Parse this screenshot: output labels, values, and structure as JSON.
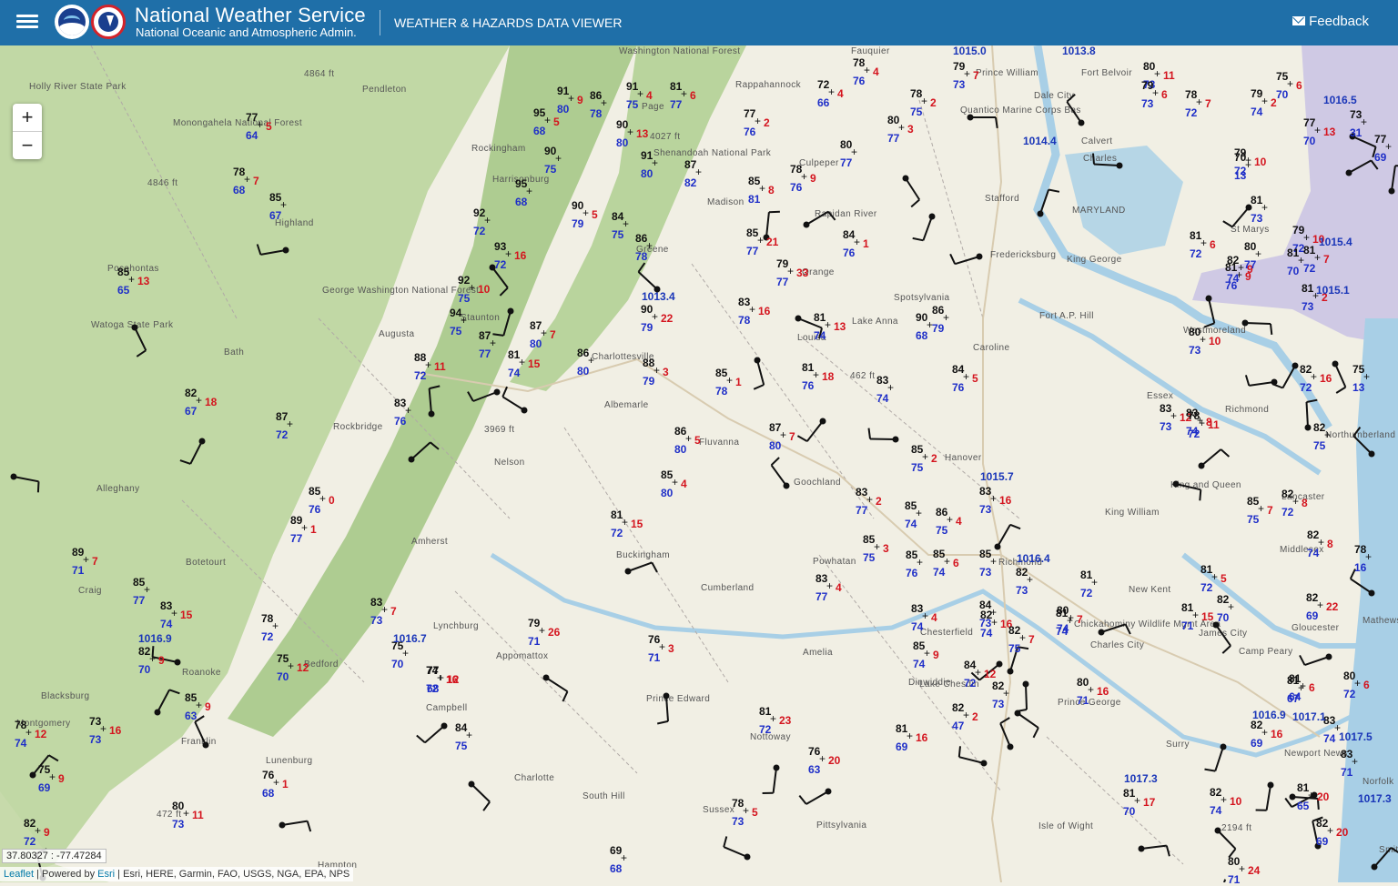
{
  "header": {
    "menu_icon": "hamburger-menu-icon",
    "title": "National Weather Service",
    "subtitle": "National Oceanic and Atmospheric Admin.",
    "app_title": "WEATHER & HAZARDS DATA VIEWER",
    "feedback_label": "Feedback",
    "feedback_icon": "envelope-icon",
    "color": "#1f6fa8"
  },
  "map": {
    "zoom_in": "+",
    "zoom_out": "−",
    "coordinates": "37.80327 : -77.47284",
    "attribution": {
      "leaflet": "Leaflet",
      "powered": " | Powered by ",
      "esri": "Esri",
      "rest": " | Esri, HERE, Garmin, FAO, USGS, NGA, EPA, NPS"
    },
    "colors": {
      "temperature": "#111111",
      "dewpoint": "#1f2fc8",
      "gust": "#d4141e",
      "pressure": "#1a36b8",
      "terrain": "#a9c98a",
      "water": "#a8cfe6",
      "marine_zone": "#c9c2e4"
    },
    "place_labels": [
      "Holly River State Park",
      "Monongahela National Forest",
      "4864 ft",
      "Pendleton",
      "Washington National Forest",
      "Fauquier",
      "Prince William",
      "Dale City",
      "Fort Belvoir",
      "Rappahannock",
      "Page",
      "4027 ft",
      "Shenandoah National Park",
      "Rockingham",
      "Harrisonburg",
      "4846 ft",
      "Highland",
      "Culpeper",
      "Quantico Marine Corps Bas",
      "Charles",
      "Calvert",
      "Madison",
      "Stafford",
      "Greene",
      "Pocahontas",
      "Rapidan River",
      "Fredericksburg",
      "King George",
      "MARYLAND",
      "St Marys",
      "George Washington National Forest",
      "Watoga State Park",
      "Staunton",
      "Augusta",
      "Orange",
      "Spotsylvania",
      "Fort A.P. Hill",
      "Caroline",
      "Westmoreland",
      "Charlottesville",
      "Albemarle",
      "Louisa",
      "Lake Anna",
      "462 ft",
      "Bath",
      "Rockbridge",
      "3969 ft",
      "Fluvanna",
      "Essex",
      "Richmond",
      "Northumberland",
      "Alleghany",
      "Nelson",
      "Goochland",
      "Hanover",
      "King and Queen",
      "King William",
      "Lancaster",
      "Amherst",
      "Buckingham",
      "Botetourt",
      "Richmond",
      "Middlesex",
      "New Kent",
      "Craig",
      "Cumberland",
      "Powhatan",
      "Gloucester",
      "Mathews",
      "Lynchburg",
      "Appomattox",
      "Amelia",
      "Chesterfield",
      "Chickahominy Wildlife Mgmt Area",
      "Charles City",
      "James City",
      "Camp Peary",
      "Roanoke",
      "Bedford",
      "Blacksburg",
      "Montgomery",
      "Franklin",
      "Campbell",
      "Prince Edward",
      "Nottoway",
      "Dinwiddie",
      "Lake Chesdin",
      "Prince George",
      "Surry",
      "Newport News",
      "Charlotte",
      "South Hill",
      "Lunenburg",
      "Sussex",
      "Isle of Wight",
      "2194 ft",
      "472 ft",
      "Pittsylvania",
      "Hampton",
      "Norfolk",
      "Smith Mtn Lake"
    ],
    "stations": [
      {
        "t": "79",
        "d": "73",
        "g": "7"
      },
      {
        "t": "78",
        "d": "76",
        "g": "4"
      },
      {
        "t": "77",
        "d": "64",
        "g": "5"
      },
      {
        "t": "91",
        "d": "80",
        "g": "9"
      },
      {
        "t": "86",
        "d": "78"
      },
      {
        "t": "91",
        "d": "75",
        "g": "4"
      },
      {
        "t": "81",
        "d": "77",
        "g": "6"
      },
      {
        "t": "95",
        "d": "68",
        "g": "5"
      },
      {
        "t": "90",
        "d": "80",
        "g": "13"
      },
      {
        "t": "72",
        "d": "66",
        "g": "4"
      },
      {
        "t": "77",
        "d": "76",
        "g": "2"
      },
      {
        "t": "78",
        "d": "75",
        "g": "2"
      },
      {
        "t": "80",
        "d": "77",
        "g": "3"
      },
      {
        "t": "90",
        "d": "75"
      },
      {
        "t": "91",
        "d": "80"
      },
      {
        "t": "87",
        "d": "82"
      },
      {
        "t": "85",
        "d": "81",
        "g": "8"
      },
      {
        "t": "80",
        "d": "77"
      },
      {
        "t": "78",
        "d": "76",
        "g": "9"
      },
      {
        "t": "85",
        "d": "77",
        "g": "21"
      },
      {
        "t": "78",
        "d": "68",
        "g": "7"
      },
      {
        "t": "85",
        "d": "67"
      },
      {
        "t": "95",
        "d": "68"
      },
      {
        "t": "92",
        "d": "72"
      },
      {
        "t": "90",
        "d": "79",
        "g": "5"
      },
      {
        "t": "84",
        "d": "75"
      },
      {
        "t": "86",
        "d": "78"
      },
      {
        "t": "93",
        "d": "72",
        "g": "16"
      },
      {
        "t": "92",
        "d": "75",
        "g": "10"
      },
      {
        "t": "94",
        "d": "75"
      },
      {
        "t": "84",
        "d": "76",
        "g": "1"
      },
      {
        "t": "79",
        "d": "77",
        "g": "33"
      },
      {
        "t": "85",
        "d": "65",
        "g": "13"
      },
      {
        "t": "87",
        "d": "80",
        "g": "7"
      },
      {
        "t": "87",
        "d": "77"
      },
      {
        "t": "81",
        "d": "74",
        "g": "15"
      },
      {
        "t": "86",
        "d": "80"
      },
      {
        "t": "88",
        "d": "79",
        "g": "3"
      },
      {
        "t": "90",
        "d": "79",
        "g": "22"
      },
      {
        "t": "83",
        "d": "78",
        "g": "16"
      },
      {
        "t": "81",
        "d": "74",
        "g": "13"
      },
      {
        "t": "86",
        "d": "79"
      },
      {
        "t": "88",
        "d": "72",
        "g": "11"
      },
      {
        "t": "85",
        "d": "78",
        "g": "1"
      },
      {
        "t": "81",
        "d": "76",
        "g": "18"
      },
      {
        "t": "83",
        "d": "74"
      },
      {
        "t": "82",
        "d": "67",
        "g": "18"
      },
      {
        "t": "83",
        "d": "76"
      },
      {
        "t": "87",
        "d": "72"
      },
      {
        "t": "86",
        "d": "80",
        "g": "5"
      },
      {
        "t": "87",
        "d": "80",
        "g": "7"
      },
      {
        "t": "85",
        "d": "80",
        "g": "4"
      },
      {
        "t": "85",
        "d": "75",
        "g": "2"
      },
      {
        "t": "84",
        "d": "76",
        "g": "5"
      },
      {
        "t": "85",
        "d": "76",
        "g": "0"
      },
      {
        "t": "89",
        "d": "77",
        "g": "1"
      },
      {
        "t": "81",
        "d": "72",
        "g": "15"
      },
      {
        "t": "83",
        "d": "77",
        "g": "2"
      },
      {
        "t": "85",
        "d": "74"
      },
      {
        "t": "86",
        "d": "75",
        "g": "4"
      },
      {
        "t": "83",
        "d": "73",
        "g": "16"
      },
      {
        "t": "85",
        "d": "75",
        "g": "3"
      },
      {
        "t": "85",
        "d": "76"
      },
      {
        "t": "85",
        "d": "74",
        "g": "6"
      },
      {
        "t": "85",
        "d": "73"
      },
      {
        "t": "82",
        "d": "73"
      },
      {
        "t": "83",
        "d": "77",
        "g": "4"
      },
      {
        "t": "89",
        "d": "71",
        "g": "7"
      },
      {
        "t": "84",
        "d": "73"
      },
      {
        "t": "85",
        "d": "77"
      },
      {
        "t": "83",
        "d": "74",
        "g": "15"
      },
      {
        "t": "83",
        "d": "73",
        "g": "7"
      },
      {
        "t": "78",
        "d": "72"
      },
      {
        "t": "82",
        "d": "70",
        "g": "9"
      },
      {
        "t": "81",
        "d": "72"
      },
      {
        "t": "75",
        "d": "70"
      },
      {
        "t": "74",
        "d": "72",
        "g": "16"
      },
      {
        "t": "79",
        "d": "71",
        "g": "26"
      },
      {
        "t": "76",
        "d": "71",
        "g": "3"
      },
      {
        "t": "75",
        "d": "70",
        "g": "12"
      },
      {
        "t": "77",
        "d": "68",
        "g": "12"
      },
      {
        "t": "85",
        "d": "63",
        "g": "9"
      },
      {
        "t": "78",
        "d": "74",
        "g": "12"
      },
      {
        "t": "73",
        "d": "73",
        "g": "16"
      },
      {
        "t": "84",
        "d": "75"
      },
      {
        "t": "83",
        "d": "74",
        "g": "4"
      },
      {
        "t": "85",
        "d": "74",
        "g": "9"
      },
      {
        "t": "82",
        "d": "74",
        "g": "16"
      },
      {
        "t": "82",
        "d": "75",
        "g": "7"
      },
      {
        "t": "84",
        "d": "72",
        "g": "12"
      },
      {
        "t": "82",
        "d": "73"
      },
      {
        "t": "82",
        "d": "47",
        "g": "2"
      },
      {
        "t": "81",
        "d": "69",
        "g": "16"
      },
      {
        "t": "81",
        "d": "72",
        "g": "23"
      },
      {
        "t": "76",
        "d": "63",
        "g": "20"
      },
      {
        "t": "78",
        "d": "73",
        "g": "5"
      },
      {
        "t": "75",
        "d": "69",
        "g": "9"
      },
      {
        "t": "76",
        "d": "68",
        "g": "1"
      },
      {
        "t": "80",
        "d": "73",
        "g": "11"
      },
      {
        "t": "82",
        "d": "72",
        "g": "9"
      },
      {
        "t": "81",
        "d": "74"
      },
      {
        "t": "80",
        "d": "74",
        "g": "7"
      },
      {
        "t": "80",
        "d": "71",
        "g": "16"
      },
      {
        "t": "81",
        "d": "72",
        "g": "5"
      },
      {
        "t": "81",
        "d": "71",
        "g": "15"
      },
      {
        "t": "82",
        "d": "69",
        "g": "22"
      },
      {
        "t": "82",
        "d": "74",
        "g": "8"
      },
      {
        "t": "78",
        "d": "16"
      },
      {
        "t": "83",
        "d": "73",
        "g": "12"
      },
      {
        "t": "85",
        "d": "75",
        "g": "7"
      },
      {
        "t": "82",
        "d": "72",
        "g": "8"
      },
      {
        "t": "82",
        "d": "75"
      },
      {
        "t": "83",
        "d": "74",
        "g": "8"
      },
      {
        "t": "78",
        "d": "72",
        "g": "11"
      },
      {
        "t": "75",
        "d": "13"
      },
      {
        "t": "82",
        "d": "72",
        "g": "16"
      },
      {
        "t": "80",
        "d": "73",
        "g": "10"
      },
      {
        "t": "81",
        "d": "76",
        "g": "9"
      },
      {
        "t": "82",
        "d": "74",
        "g": "9"
      },
      {
        "t": "70",
        "d": "13"
      },
      {
        "t": "81",
        "d": "73",
        "g": "2"
      },
      {
        "t": "79",
        "d": "72",
        "g": "10"
      },
      {
        "t": "81",
        "d": "72",
        "g": "6"
      },
      {
        "t": "82",
        "d": "70"
      },
      {
        "t": "82",
        "d": "69",
        "g": "16"
      },
      {
        "t": "83",
        "d": "71"
      },
      {
        "t": "81",
        "d": "70",
        "g": "17"
      },
      {
        "t": "82",
        "d": "74",
        "g": "10"
      },
      {
        "t": "81",
        "d": "65",
        "g": "20"
      },
      {
        "t": "82",
        "d": "69",
        "g": "20"
      },
      {
        "t": "80",
        "d": "71",
        "g": "24"
      },
      {
        "t": "81",
        "d": "64",
        "g": "6"
      },
      {
        "t": "81",
        "d": "67"
      },
      {
        "t": "80",
        "d": "72",
        "g": "6"
      },
      {
        "t": "83",
        "d": "74"
      },
      {
        "t": "69",
        "d": "68"
      },
      {
        "t": "80",
        "d": "73",
        "g": "11"
      },
      {
        "t": "79",
        "d": "73",
        "g": "6"
      },
      {
        "t": "78",
        "d": "72",
        "g": "7"
      },
      {
        "t": "79",
        "d": "74",
        "g": "2"
      },
      {
        "t": "75",
        "d": "70",
        "g": "6"
      },
      {
        "t": "77",
        "d": "70",
        "g": "13"
      },
      {
        "t": "73",
        "d": "31"
      },
      {
        "t": "77",
        "d": "69"
      },
      {
        "t": "79",
        "d": "72",
        "g": "10"
      },
      {
        "t": "81",
        "d": "73"
      },
      {
        "t": "81",
        "d": "72",
        "g": "7"
      },
      {
        "t": "81",
        "d": "70"
      },
      {
        "t": "80",
        "d": "77"
      },
      {
        "t": "90",
        "d": "68"
      }
    ],
    "pressures": [
      "1015.0",
      "1013.8",
      "1016.5",
      "1014.4",
      "1015.4",
      "1015.1",
      "1013.4",
      "1015.7",
      "1016.7",
      "1016.9",
      "1016.9",
      "1017.1",
      "1017.5",
      "1017.3",
      "1017.3",
      "1016.4"
    ]
  }
}
